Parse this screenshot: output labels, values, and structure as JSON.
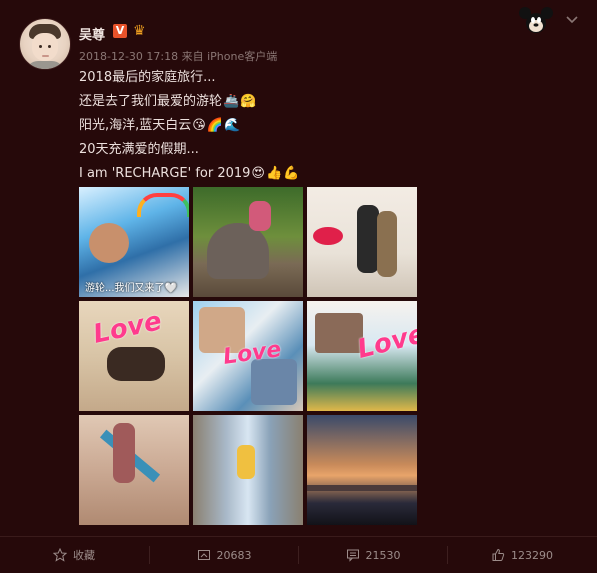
{
  "post": {
    "author": "吴尊",
    "verified_label": "V",
    "meta": "2018-12-30 17:18  来自 iPhone客户端",
    "lines": [
      {
        "text": "2018最后的家庭旅行...",
        "emojis": []
      },
      {
        "text": "还是去了我们最爱的游轮",
        "emojis": [
          "🚢",
          "🤗"
        ]
      },
      {
        "text": "阳光,海洋,蓝天白云",
        "emojis": [
          "😘",
          "🌈",
          "🌊"
        ]
      },
      {
        "text": "20天充满爱的假期...",
        "emojis": []
      },
      {
        "text": "I am 'RECHARGE' for 2019",
        "emojis": [
          "😍",
          "👍",
          "💪"
        ]
      }
    ]
  },
  "photos": [
    {
      "caption": "游轮...我们又来了🤍",
      "deco": ""
    },
    {
      "caption": "",
      "deco": ""
    },
    {
      "caption": "",
      "deco": ""
    },
    {
      "caption": "",
      "deco": "Love"
    },
    {
      "caption": "",
      "deco": "Love"
    },
    {
      "caption": "",
      "deco": "Love"
    },
    {
      "caption": "",
      "deco": ""
    },
    {
      "caption": "",
      "deco": ""
    },
    {
      "caption": "",
      "deco": ""
    }
  ],
  "footer": {
    "favorite_label": "收藏",
    "repost_count": "20683",
    "comment_count": "21530",
    "like_count": "123290"
  },
  "colors": {
    "background": "#26090a",
    "verified": "#e8522a",
    "footer_text": "#9c8c8a"
  }
}
